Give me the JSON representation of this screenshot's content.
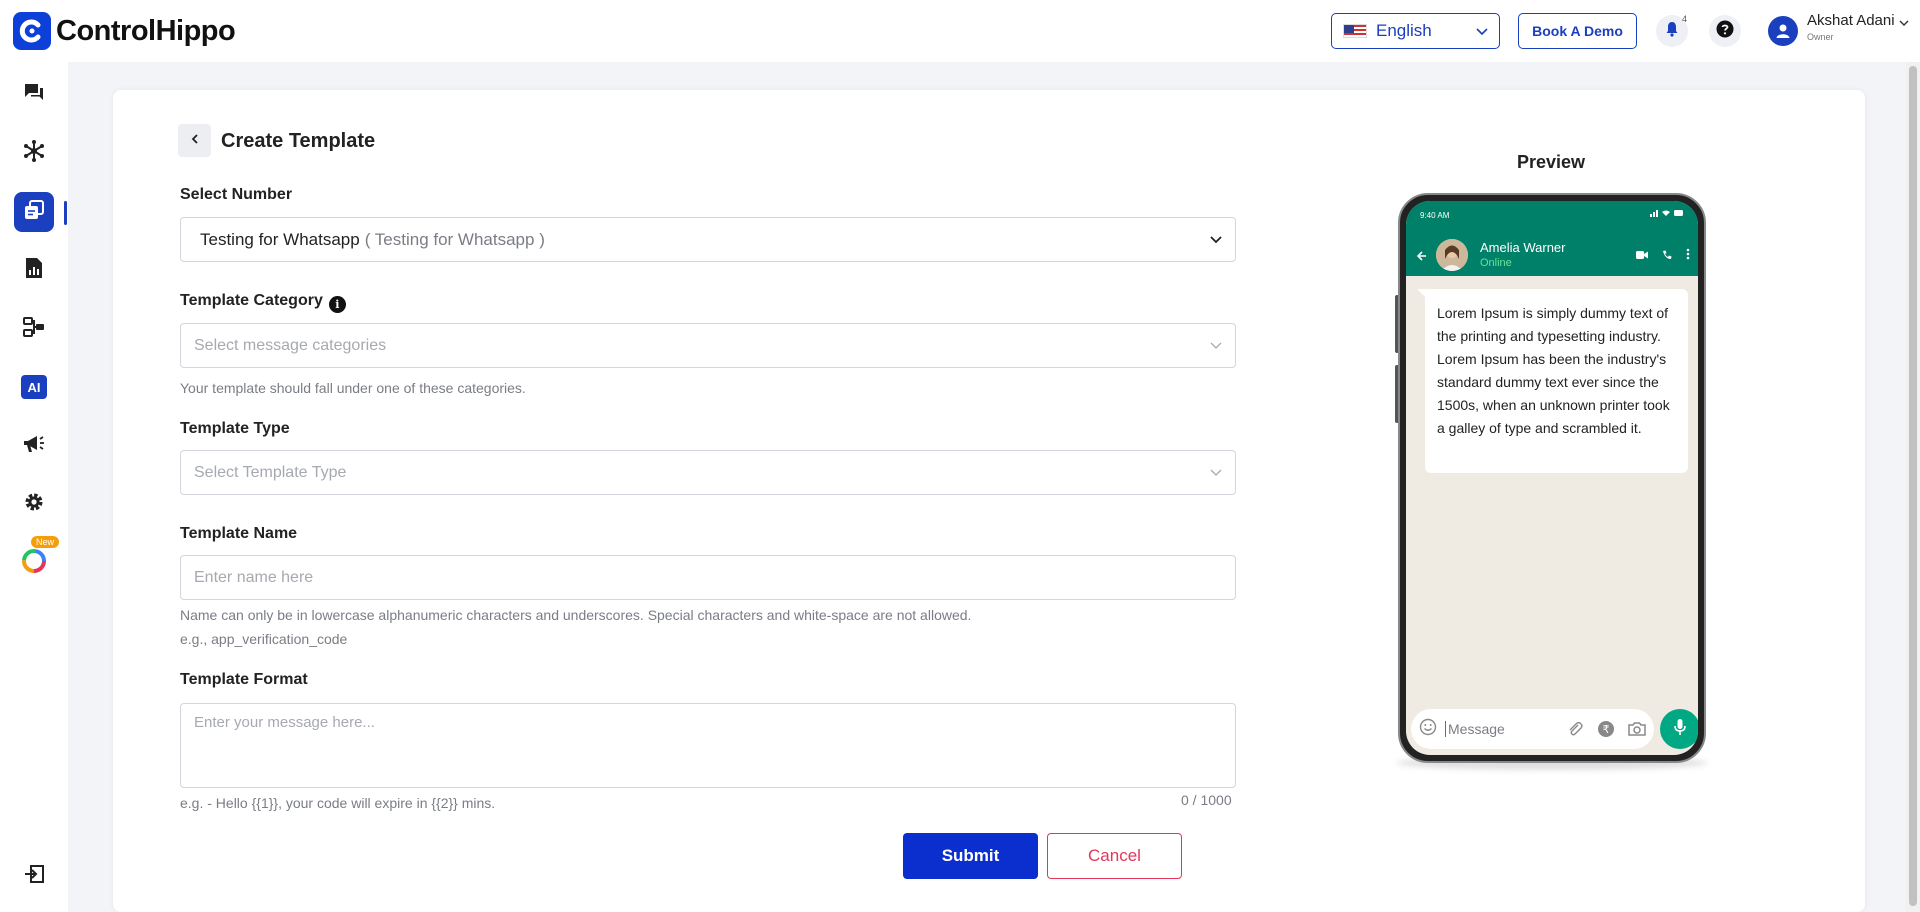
{
  "app": {
    "name": "ControlHippo"
  },
  "header": {
    "language": "English",
    "demo_button": "Book A Demo",
    "notification_count": "4",
    "user_name": "Akshat Adani",
    "user_role": "Owner"
  },
  "sidebar": {
    "items": [
      "chat-icon",
      "network-icon",
      "templates-icon",
      "reports-icon",
      "workflow-icon",
      "ai-icon",
      "campaign-icon",
      "settings-icon",
      "new-feature-icon"
    ],
    "ai_label": "AI",
    "new_badge": "New"
  },
  "form": {
    "title": "Create Template",
    "select_number": {
      "label": "Select Number",
      "value": "Testing for Whatsapp",
      "sub_value": "( Testing for Whatsapp )"
    },
    "category": {
      "label": "Template Category",
      "placeholder": "Select message categories",
      "helper": "Your template should fall under one of these categories."
    },
    "type": {
      "label": "Template Type",
      "placeholder": "Select Template Type"
    },
    "name": {
      "label": "Template Name",
      "placeholder": "Enter name here",
      "helper_1": "Name can only be in lowercase alphanumeric characters and underscores. Special characters and white-space are not allowed.",
      "helper_2": "e.g., app_verification_code"
    },
    "format": {
      "label": "Template Format",
      "placeholder": "Enter your message here...",
      "helper": "e.g. - Hello {{1}}, your code will expire in {{2}} mins.",
      "counter": "0 / 1000"
    },
    "submit": "Submit",
    "cancel": "Cancel"
  },
  "preview": {
    "title": "Preview",
    "time": "9:40 AM",
    "contact_name": "Amelia Warner",
    "contact_status": "Online",
    "message": "Lorem Ipsum is simply dummy text of the printing and typesetting industry. Lorem Ipsum has been the industry's standard dummy text ever since the 1500s, when an unknown printer took a galley of type and scrambled it.",
    "input_placeholder": "Message"
  },
  "colors": {
    "brand": "#1a3fbf",
    "whatsapp": "#008069",
    "cancel": "#e2365a"
  }
}
